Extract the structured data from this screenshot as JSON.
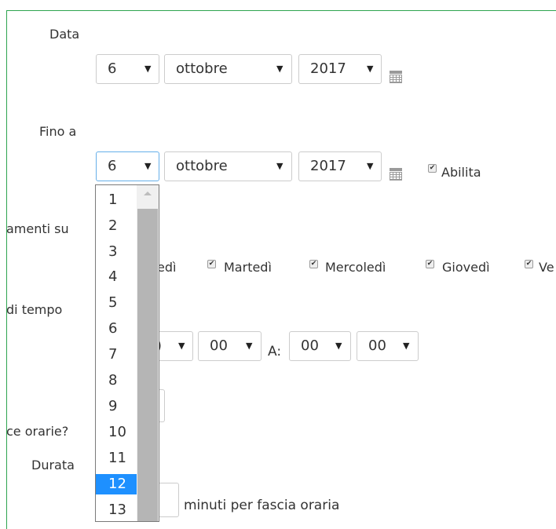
{
  "data_section": {
    "label": "Data",
    "day": "6",
    "month": "ottobre",
    "year": "2017"
  },
  "fino_section": {
    "label": "Fino a",
    "day": "6",
    "month": "ottobre",
    "year": "2017",
    "abilita_label": "Abilita",
    "abilita_checked": true
  },
  "repeat_section": {
    "label_partial": "amenti su",
    "days": [
      {
        "label": "edì",
        "checked": true
      },
      {
        "label": "Martedì",
        "checked": true
      },
      {
        "label": "Mercoledì",
        "checked": true
      },
      {
        "label": "Giovedì",
        "checked": true
      },
      {
        "label": "Ve",
        "checked": true
      }
    ]
  },
  "time_section": {
    "label_partial": "di tempo",
    "from_hour_partial": ")",
    "from_minute": "00",
    "to_label": "A:",
    "to_hour": "00",
    "to_minute": "00"
  },
  "slots_section": {
    "label_partial": "ce orarie?"
  },
  "duration_section": {
    "label": "Durata",
    "suffix": "minuti per fascia oraria"
  },
  "day_dropdown": {
    "options": [
      "1",
      "2",
      "3",
      "4",
      "5",
      "6",
      "7",
      "8",
      "9",
      "10",
      "11",
      "12",
      "13"
    ],
    "highlighted": "12"
  },
  "icons": {
    "arrow": "▼",
    "check": "✔"
  },
  "colors": {
    "frame_border": "#2ea44f",
    "highlight": "#1e90ff",
    "focus_border": "#66afe9"
  }
}
